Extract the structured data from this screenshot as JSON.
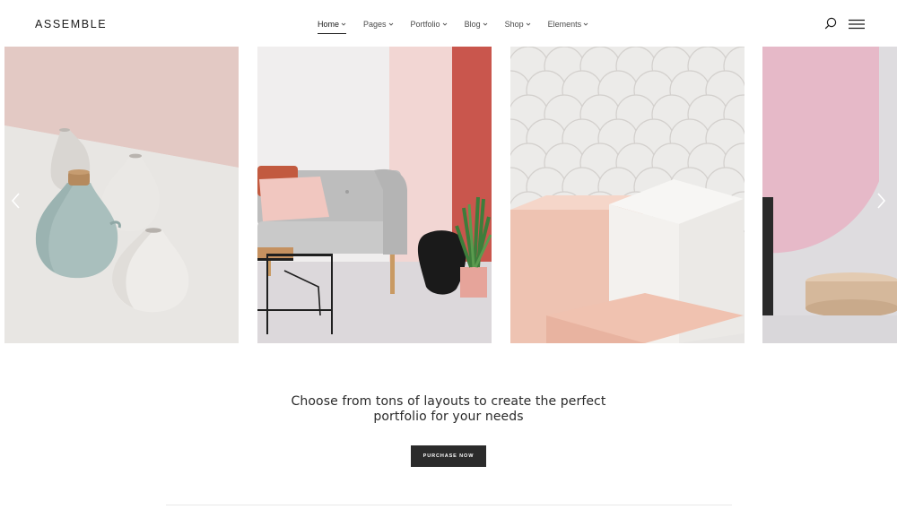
{
  "brand": {
    "logo": "ASSEMBLE"
  },
  "nav": {
    "items": [
      {
        "label": "Home",
        "active": true
      },
      {
        "label": "Pages"
      },
      {
        "label": "Portfolio"
      },
      {
        "label": "Blog"
      },
      {
        "label": "Shop"
      },
      {
        "label": "Elements"
      }
    ],
    "search_icon": "search-icon",
    "menu_icon": "hamburger-icon"
  },
  "slider": {
    "slides": [
      {
        "subject": "ceramic vases on pink and white surfaces"
      },
      {
        "subject": "grey sofa with pink cushion, coffee table and plant"
      },
      {
        "subject": "white scalloped wall tiles with pink and white blocks"
      },
      {
        "subject": "pink arched shape with round wooden tray"
      }
    ],
    "prev_icon": "chevron-left-icon",
    "next_icon": "chevron-right-icon"
  },
  "cta": {
    "line1": "Choose from tons of layouts to create the perfect",
    "line2": "portfolio for your needs",
    "button": "PURCHASE NOW"
  },
  "colors": {
    "text": "#1a1a1a",
    "button_bg": "#2b2b2b",
    "button_text": "#ffffff",
    "blush_pink": "#e8c8c4",
    "terracotta": "#c9564d"
  }
}
